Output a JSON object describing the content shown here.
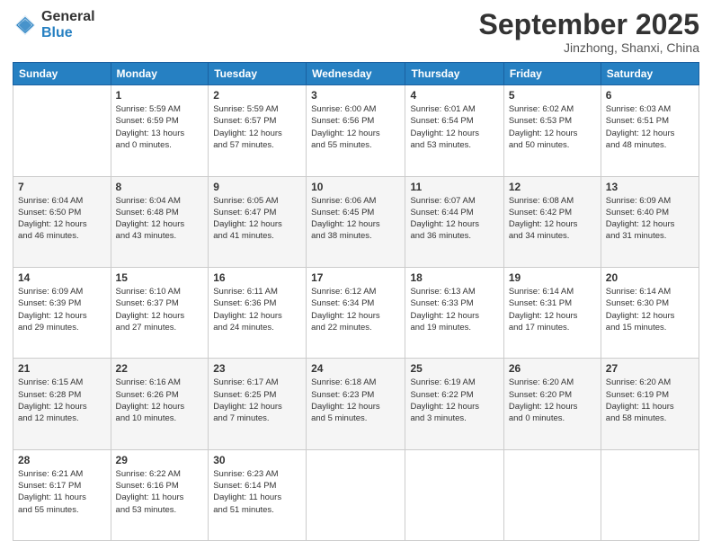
{
  "logo": {
    "general": "General",
    "blue": "Blue"
  },
  "header": {
    "month": "September 2025",
    "location": "Jinzhong, Shanxi, China"
  },
  "weekdays": [
    "Sunday",
    "Monday",
    "Tuesday",
    "Wednesday",
    "Thursday",
    "Friday",
    "Saturday"
  ],
  "weeks": [
    [
      {
        "day": "",
        "info": ""
      },
      {
        "day": "1",
        "info": "Sunrise: 5:59 AM\nSunset: 6:59 PM\nDaylight: 13 hours\nand 0 minutes."
      },
      {
        "day": "2",
        "info": "Sunrise: 5:59 AM\nSunset: 6:57 PM\nDaylight: 12 hours\nand 57 minutes."
      },
      {
        "day": "3",
        "info": "Sunrise: 6:00 AM\nSunset: 6:56 PM\nDaylight: 12 hours\nand 55 minutes."
      },
      {
        "day": "4",
        "info": "Sunrise: 6:01 AM\nSunset: 6:54 PM\nDaylight: 12 hours\nand 53 minutes."
      },
      {
        "day": "5",
        "info": "Sunrise: 6:02 AM\nSunset: 6:53 PM\nDaylight: 12 hours\nand 50 minutes."
      },
      {
        "day": "6",
        "info": "Sunrise: 6:03 AM\nSunset: 6:51 PM\nDaylight: 12 hours\nand 48 minutes."
      }
    ],
    [
      {
        "day": "7",
        "info": "Sunrise: 6:04 AM\nSunset: 6:50 PM\nDaylight: 12 hours\nand 46 minutes."
      },
      {
        "day": "8",
        "info": "Sunrise: 6:04 AM\nSunset: 6:48 PM\nDaylight: 12 hours\nand 43 minutes."
      },
      {
        "day": "9",
        "info": "Sunrise: 6:05 AM\nSunset: 6:47 PM\nDaylight: 12 hours\nand 41 minutes."
      },
      {
        "day": "10",
        "info": "Sunrise: 6:06 AM\nSunset: 6:45 PM\nDaylight: 12 hours\nand 38 minutes."
      },
      {
        "day": "11",
        "info": "Sunrise: 6:07 AM\nSunset: 6:44 PM\nDaylight: 12 hours\nand 36 minutes."
      },
      {
        "day": "12",
        "info": "Sunrise: 6:08 AM\nSunset: 6:42 PM\nDaylight: 12 hours\nand 34 minutes."
      },
      {
        "day": "13",
        "info": "Sunrise: 6:09 AM\nSunset: 6:40 PM\nDaylight: 12 hours\nand 31 minutes."
      }
    ],
    [
      {
        "day": "14",
        "info": "Sunrise: 6:09 AM\nSunset: 6:39 PM\nDaylight: 12 hours\nand 29 minutes."
      },
      {
        "day": "15",
        "info": "Sunrise: 6:10 AM\nSunset: 6:37 PM\nDaylight: 12 hours\nand 27 minutes."
      },
      {
        "day": "16",
        "info": "Sunrise: 6:11 AM\nSunset: 6:36 PM\nDaylight: 12 hours\nand 24 minutes."
      },
      {
        "day": "17",
        "info": "Sunrise: 6:12 AM\nSunset: 6:34 PM\nDaylight: 12 hours\nand 22 minutes."
      },
      {
        "day": "18",
        "info": "Sunrise: 6:13 AM\nSunset: 6:33 PM\nDaylight: 12 hours\nand 19 minutes."
      },
      {
        "day": "19",
        "info": "Sunrise: 6:14 AM\nSunset: 6:31 PM\nDaylight: 12 hours\nand 17 minutes."
      },
      {
        "day": "20",
        "info": "Sunrise: 6:14 AM\nSunset: 6:30 PM\nDaylight: 12 hours\nand 15 minutes."
      }
    ],
    [
      {
        "day": "21",
        "info": "Sunrise: 6:15 AM\nSunset: 6:28 PM\nDaylight: 12 hours\nand 12 minutes."
      },
      {
        "day": "22",
        "info": "Sunrise: 6:16 AM\nSunset: 6:26 PM\nDaylight: 12 hours\nand 10 minutes."
      },
      {
        "day": "23",
        "info": "Sunrise: 6:17 AM\nSunset: 6:25 PM\nDaylight: 12 hours\nand 7 minutes."
      },
      {
        "day": "24",
        "info": "Sunrise: 6:18 AM\nSunset: 6:23 PM\nDaylight: 12 hours\nand 5 minutes."
      },
      {
        "day": "25",
        "info": "Sunrise: 6:19 AM\nSunset: 6:22 PM\nDaylight: 12 hours\nand 3 minutes."
      },
      {
        "day": "26",
        "info": "Sunrise: 6:20 AM\nSunset: 6:20 PM\nDaylight: 12 hours\nand 0 minutes."
      },
      {
        "day": "27",
        "info": "Sunrise: 6:20 AM\nSunset: 6:19 PM\nDaylight: 11 hours\nand 58 minutes."
      }
    ],
    [
      {
        "day": "28",
        "info": "Sunrise: 6:21 AM\nSunset: 6:17 PM\nDaylight: 11 hours\nand 55 minutes."
      },
      {
        "day": "29",
        "info": "Sunrise: 6:22 AM\nSunset: 6:16 PM\nDaylight: 11 hours\nand 53 minutes."
      },
      {
        "day": "30",
        "info": "Sunrise: 6:23 AM\nSunset: 6:14 PM\nDaylight: 11 hours\nand 51 minutes."
      },
      {
        "day": "",
        "info": ""
      },
      {
        "day": "",
        "info": ""
      },
      {
        "day": "",
        "info": ""
      },
      {
        "day": "",
        "info": ""
      }
    ]
  ]
}
